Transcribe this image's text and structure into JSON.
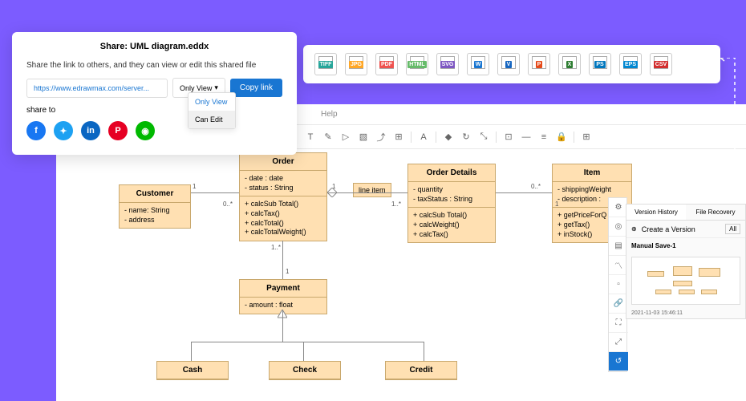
{
  "share": {
    "title": "Share: UML diagram.eddx",
    "description": "Share the link to others, and they can view or edit this shared file",
    "url": "https://www.edrawmax.com/server...",
    "permission": "Only View",
    "copy_label": "Copy link",
    "share_to_label": "share to",
    "options": {
      "view": "Only View",
      "edit": "Can Edit"
    }
  },
  "exports": [
    "TIFF",
    "JPG",
    "PDF",
    "HTML",
    "SVG",
    "W",
    "V",
    "P",
    "X",
    "PS",
    "EPS",
    "CSV"
  ],
  "toolbar": {
    "help": "Help"
  },
  "uml": {
    "customer": {
      "name": "Customer",
      "attrs": [
        "name: String",
        "address"
      ]
    },
    "order": {
      "name": "Order",
      "attrs": [
        "date : date",
        "status : String"
      ],
      "ops": [
        "calcSub Total()",
        "calcTax()",
        "calcTotal()",
        "calcTotalWeight()"
      ]
    },
    "orderdetails": {
      "name": "Order Details",
      "attrs": [
        "quantity",
        "taxStatus : String"
      ],
      "ops": [
        "calcSub Total()",
        "calcWeight()",
        "calcTax()"
      ]
    },
    "item": {
      "name": "Item",
      "attrs": [
        "shippingWeight",
        "description :"
      ],
      "ops": [
        "getPriceForQ",
        "getTax()",
        "inStock()"
      ]
    },
    "payment": {
      "name": "Payment",
      "attrs": [
        "amount : float"
      ]
    },
    "cash": "Cash",
    "check": "Check",
    "credit": "Credit",
    "lineitem_tag": "line item",
    "mult": {
      "one": "1",
      "zerostar": "0..*",
      "onestar": "1..*"
    }
  },
  "history": {
    "tab1": "Version History",
    "tab2": "File Recovery",
    "create": "Create a Version",
    "filter": "All",
    "entry": "Manual Save-1",
    "time": "2021-11-03 15:46:11"
  }
}
